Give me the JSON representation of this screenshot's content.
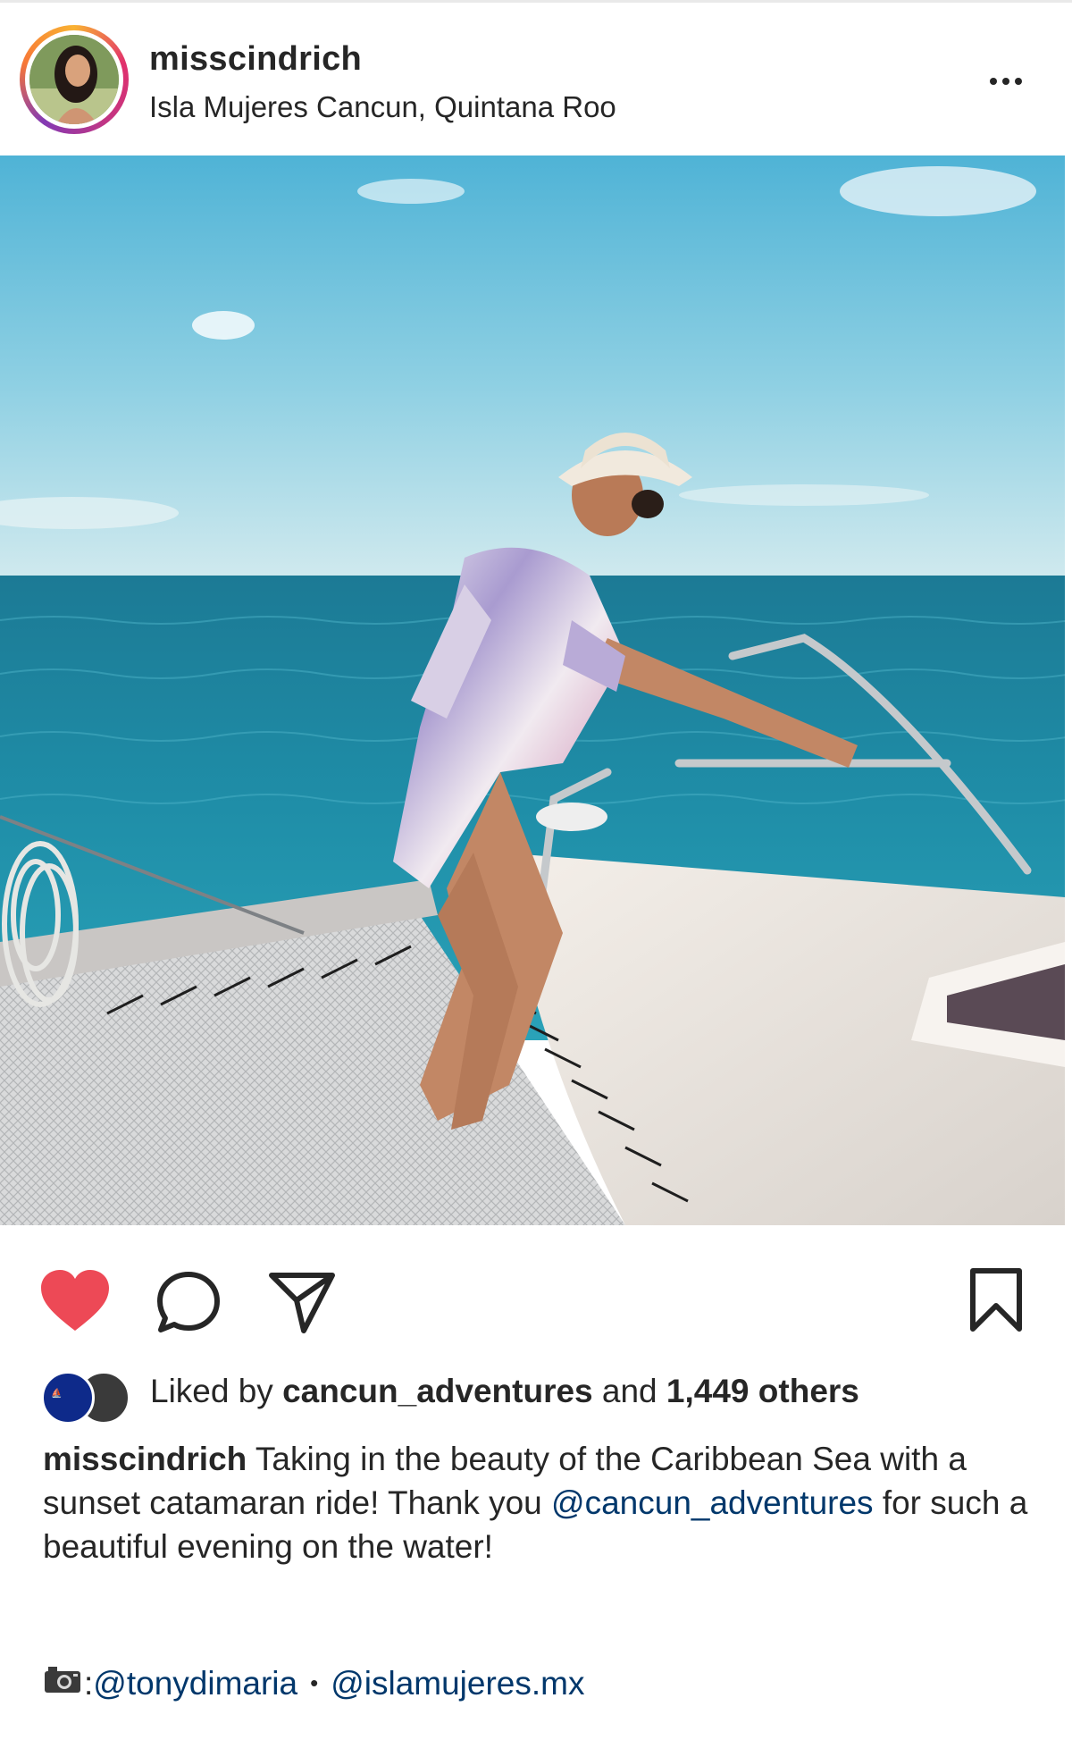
{
  "post": {
    "username": "misscindrich",
    "location": "Isla Mujeres Cancun, Quintana Roo",
    "more_icon": "more-horizontal-icon",
    "image_alt": "Woman in tie-dye dress and straw hat sitting on catamaran over the Caribbean Sea"
  },
  "actions": {
    "like_icon": "heart-filled-icon",
    "comment_icon": "comment-icon",
    "share_icon": "send-icon",
    "save_icon": "bookmark-icon",
    "like_color": "#ed4956"
  },
  "likes": {
    "prefix": "Liked by ",
    "user": "cancun_adventures",
    "middle": " and ",
    "count": "1,449 others"
  },
  "caption": {
    "username": "misscindrich",
    "text_1": " Taking in the beauty of the Caribbean Sea with a sunset catamaran ride! Thank you ",
    "mention": "@cancun_adventures",
    "text_2": " for such a beautiful evening on the water!"
  },
  "credits": {
    "separator_1": ": ",
    "mention_1": "@tonydimaria",
    "dot": "•",
    "mention_2": "@islamujeres.mx"
  },
  "colors": {
    "mention": "#00376b",
    "text": "#262626"
  }
}
